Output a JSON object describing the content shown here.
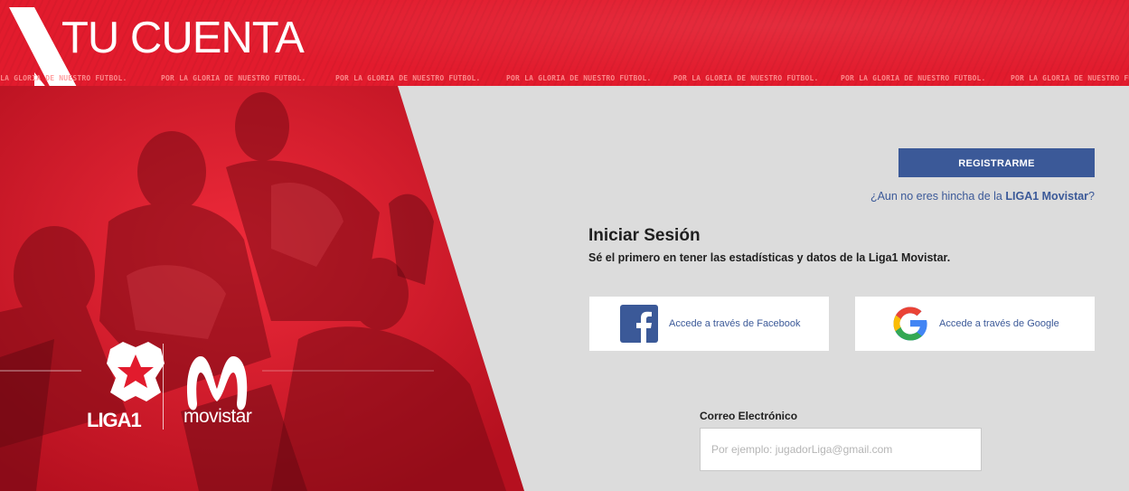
{
  "header": {
    "title": "TU CUENTA",
    "tagline": "POR LA GLORIA DE NUESTRO FÚTBOL."
  },
  "hero": {
    "liga_logo_text": "LIGA1",
    "movistar_logo_text": "movistar"
  },
  "register": {
    "button_label": "REGISTRARME",
    "prompt_prefix": "¿Aun no eres hincha de la ",
    "prompt_brand": "LIGA1 Movistar",
    "prompt_suffix": "?"
  },
  "login": {
    "title": "Iniciar Sesión",
    "subtitle": "Sé el primero en tener las estadísticas y datos de la Liga1 Movistar.",
    "facebook_label": "Accede a través de Facebook",
    "google_label": "Accede a través de Google",
    "email_label": "Correo Electrónico",
    "email_placeholder": "Por ejemplo: jugadorLiga@gmail.com",
    "email_value": ""
  },
  "icons": {
    "facebook": "facebook-icon",
    "google": "google-icon",
    "liga_badge": "liga1-badge-icon",
    "movistar": "movistar-logo-icon"
  },
  "colors": {
    "brand_red": "#e21b2d",
    "facebook_blue": "#3b5998",
    "panel_gray": "#dcdcdc"
  }
}
